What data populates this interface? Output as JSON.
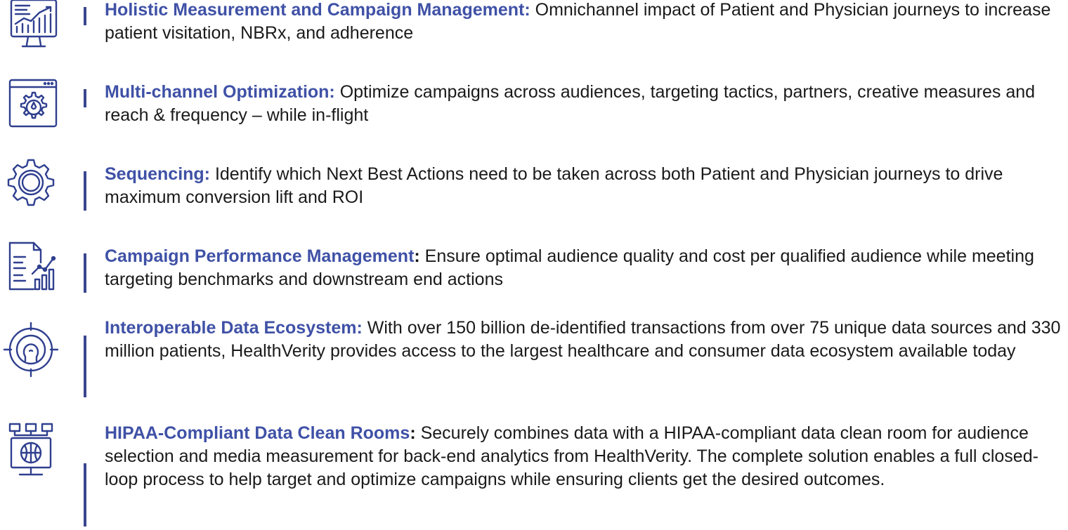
{
  "items": [
    {
      "icon": "monitor-analytics-icon",
      "heading": "Holistic Measurement and Campaign Management:",
      "colon": "",
      "body": " Omnichannel impact of Patient and Physician journeys to increase patient visitation, NBRx, and adherence"
    },
    {
      "icon": "browser-gear-icon",
      "heading": "Multi-channel Optimization:",
      "colon": "",
      "body": " Optimize campaigns across audiences, targeting tactics, partners, creative measures and reach & frequency – while in-flight"
    },
    {
      "icon": "gear-icon",
      "heading": "Sequencing:",
      "colon": "",
      "body": " Identify which Next Best Actions need to be taken across both Patient and Physician journeys to drive maximum conversion lift and ROI"
    },
    {
      "icon": "report-chart-icon",
      "heading": "Campaign Performance Management",
      "colon": ":",
      "body": " Ensure optimal audience quality and cost per qualified audience while meeting targeting benchmarks and downstream end actions"
    },
    {
      "icon": "target-person-icon",
      "heading": "Interoperable Data Ecosystem:",
      "colon": "",
      "body": " With over 150 billion de-identified transactions from over 75 unique data sources and 330 million patients, HealthVerity provides access to the largest healthcare and consumer data ecosystem available today"
    },
    {
      "icon": "network-monitor-icon",
      "heading": "HIPAA-Compliant Data Clean Rooms",
      "colon": ":",
      "body": " Securely combines data with a HIPAA-compliant data clean room for audience selection and media measurement for back-end analytics from HealthVerity.  The complete solution enables a full closed-loop process to help target and optimize campaigns while ensuring clients get the desired outcomes."
    }
  ],
  "colors": {
    "heading": "#3f51a6",
    "bar": "#39468f",
    "icon": "#2f3f8f",
    "body": "#1a1a1a"
  }
}
